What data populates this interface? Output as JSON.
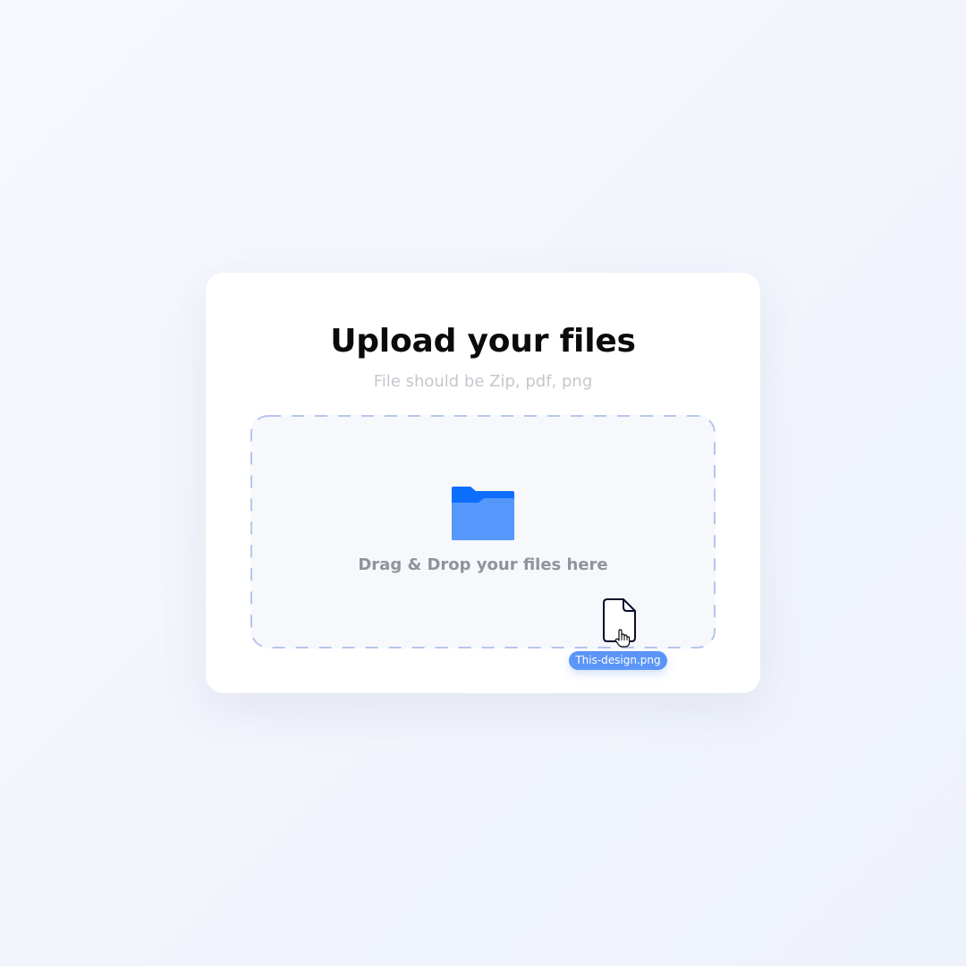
{
  "upload_card": {
    "title": "Upload your files",
    "subtitle": "File should be Zip, pdf, png"
  },
  "dropzone": {
    "label": "Drag & Drop your files here",
    "icon": "folder-icon"
  },
  "dragged_file": {
    "name": "This-design.png",
    "icon": "file-icon",
    "cursor": "hand-cursor-icon"
  },
  "colors": {
    "background": "#f2f5fc",
    "card": "#ffffff",
    "title": "#0b0b0b",
    "subtitle": "#c5c7cc",
    "dropzone_fill": "#f6f8fc",
    "dropzone_border": "#b7c6ec",
    "folder_back": "#0d6efd",
    "folder_front": "#5598fb",
    "drop_label": "#8f939b",
    "file_chip": "#5b95f7",
    "file_outline": "#0b0b2b"
  }
}
